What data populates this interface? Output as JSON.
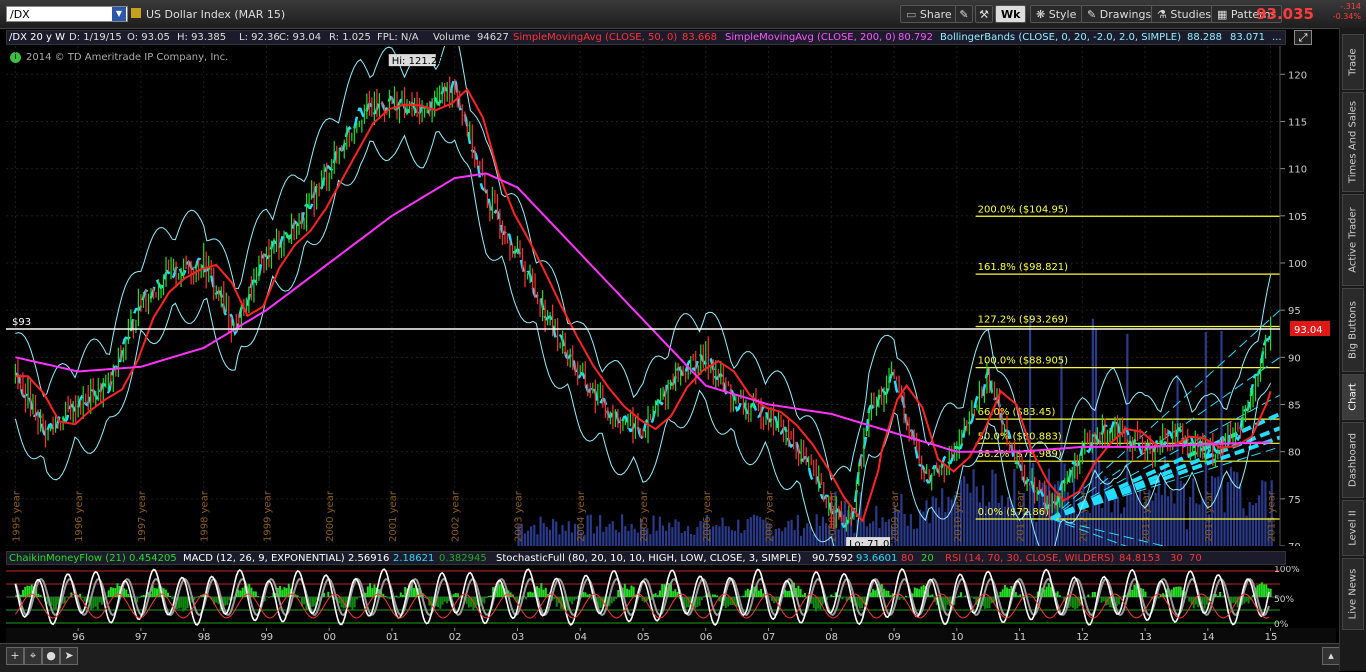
{
  "toolbar": {
    "symbol": "/DX",
    "symbol_name": "US Dollar Index (MAR 15)",
    "share": "Share",
    "wk": "Wk",
    "style": "Style",
    "drawings": "Drawings",
    "studies": "Studies",
    "patterns": "Patterns",
    "last_price": "93.035",
    "change": "-.314",
    "change_pct": "-0.34%"
  },
  "study_bar": {
    "chart_id": "/DX 20 y W",
    "date": "D: 1/19/15",
    "open": "O: 93.05",
    "high": "H: 93.385",
    "low": "L: 92.36",
    "close": "C: 93.04",
    "range": "R: 1.025",
    "fpl": "FPL: N/A",
    "volume_label": "Volume",
    "volume": "94627",
    "sma50_label": "SimpleMovingAvg (CLOSE, 50, 0)",
    "sma50": "83.668",
    "sma200_label": "SimpleMovingAvg (CLOSE, 200, 0)",
    "sma200": "80.792",
    "bb_label": "BollingerBands (CLOSE, 0, 20, -2.0, 2.0, SIMPLE)",
    "bb_upper": "88.288",
    "bb_lower": "83.071",
    "bb_more": "..."
  },
  "copyright": "2014 © TD Ameritrade IP Company, Inc.",
  "colors": {
    "price_green": "#22dd22",
    "price_red": "#ff3333",
    "sma50": "#ff2222",
    "sma200": "#ff33ff",
    "bollinger": "#8ff0ff",
    "fib": "#ffff33",
    "trendline": "#22ddff",
    "rsi": "#ff3333",
    "stochastic": "#ffffff",
    "volume": "#2a3a8a"
  },
  "annotations": {
    "hi": "Hi: 121.29",
    "lo": "Lo: 71.05",
    "level_label": "$93",
    "level_value": 93,
    "price_tag": "93.04",
    "copyright_icon": "info-icon"
  },
  "chart_data": {
    "type": "line",
    "title": "US Dollar Index (MAR 15)",
    "ylim": [
      70,
      123
    ],
    "y_ticks": [
      70,
      75,
      80,
      85,
      90,
      95,
      100,
      105,
      110,
      115,
      120
    ],
    "x_year_labels": [
      "1995 year",
      "1996 year",
      "1997 year",
      "1998 year",
      "1999 year",
      "2000 year",
      "2001 year",
      "2002 year",
      "2003 year",
      "2004 year",
      "2005 year",
      "2006 year",
      "2007 year",
      "2008 year",
      "2009 year",
      "2010 year",
      "2011 year",
      "2012 year",
      "2013 year",
      "2014 year",
      "2015 year"
    ],
    "x_lower_labels": [
      "96",
      "97",
      "98",
      "99",
      "00",
      "01",
      "02",
      "03",
      "04",
      "05",
      "06",
      "07",
      "08",
      "09",
      "10",
      "11",
      "12",
      "13",
      "14",
      "15"
    ],
    "close_series": {
      "x": [
        1995.0,
        1995.5,
        1996.0,
        1996.5,
        1997.0,
        1997.5,
        1998.0,
        1998.5,
        1999.0,
        1999.5,
        2000.0,
        2000.5,
        2001.0,
        2001.5,
        2002.0,
        2002.5,
        2003.0,
        2003.5,
        2004.0,
        2004.5,
        2005.0,
        2005.5,
        2006.0,
        2006.5,
        2007.0,
        2007.5,
        2008.0,
        2008.3,
        2008.6,
        2009.0,
        2009.5,
        2010.0,
        2010.5,
        2011.0,
        2011.5,
        2012.0,
        2012.5,
        2013.0,
        2013.5,
        2014.0,
        2014.5,
        2015.0
      ],
      "values": [
        88,
        82,
        85,
        87,
        96,
        99,
        100,
        93,
        101,
        104,
        110,
        116,
        117,
        116,
        119,
        107,
        101,
        94,
        88,
        84,
        82,
        88,
        90,
        85,
        84,
        80,
        74,
        72,
        84,
        88,
        77,
        80,
        88,
        78,
        74,
        80,
        83,
        80,
        82,
        80,
        82,
        93
      ]
    },
    "sma200_series": {
      "x": [
        1995.0,
        1996.0,
        1997.0,
        1998.0,
        1999.0,
        2000.0,
        2001.0,
        2002.0,
        2002.5,
        2003.0,
        2004.0,
        2005.0,
        2006.0,
        2007.0,
        2008.0,
        2009.0,
        2010.0,
        2011.0,
        2012.0,
        2013.0,
        2014.0,
        2015.0
      ],
      "values": [
        90,
        88.5,
        89,
        91,
        95,
        100,
        105,
        109,
        109.5,
        108,
        101,
        94,
        87,
        85,
        84,
        82,
        80,
        80,
        80.5,
        80.5,
        80.8,
        81
      ]
    },
    "fib_levels": [
      {
        "label": "200.0%",
        "price": "($104.95)",
        "value": 104.95
      },
      {
        "label": "161.8%",
        "price": "($98.821)",
        "value": 98.821
      },
      {
        "label": "127.2%",
        "price": "($93.269)",
        "value": 93.269
      },
      {
        "label": "100.0%",
        "price": "($88.905)",
        "value": 88.905
      },
      {
        "label": "66.0%",
        "price": "($83.45)",
        "value": 83.45
      },
      {
        "label": "50.0%",
        "price": "($80.883)",
        "value": 80.883
      },
      {
        "label": "38.2%",
        "price": "($78.989)",
        "value": 78.989
      },
      {
        "label": "0.0%",
        "price": "($72.86)",
        "value": 72.86
      }
    ]
  },
  "lower_panel": {
    "cmf_label": "ChaikinMoneyFlow (21)",
    "cmf": "0.454205",
    "macd_label": "MACD (12, 26, 9, EXPONENTIAL)",
    "macd_1": "2.56916",
    "macd_2": "2.18621",
    "macd_3": "0.382945",
    "stoch_label": "StochasticFull (80, 20, 10, 10, HIGH, LOW, CLOSE, 3, SIMPLE)",
    "stoch_1": "90.7592",
    "stoch_2": "93.6601",
    "stoch_3": "80",
    "stoch_4": "20",
    "rsi_label": "RSI (14, 70, 30, CLOSE, WILDERS)",
    "rsi": "84.8153",
    "rsi_lo": "30",
    "rsi_hi": "70",
    "axis_100": "100%",
    "axis_50": "50%",
    "axis_0": "0%"
  },
  "side_tabs": [
    "Trade",
    "Times And Sales",
    "Active Trader",
    "Big Buttons",
    "Chart",
    "Dashboard",
    "Level II",
    "Live News"
  ]
}
